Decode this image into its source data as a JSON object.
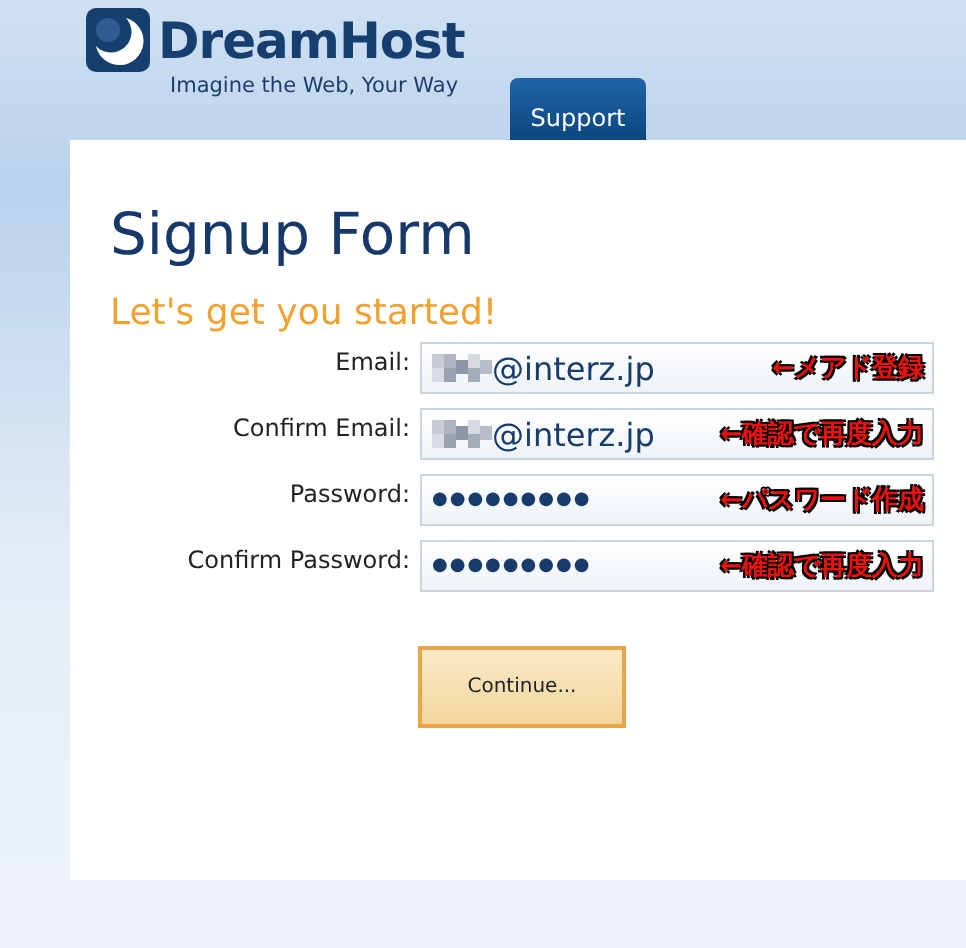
{
  "header": {
    "logo_text": "DreamHost",
    "tagline": "Imagine the Web, Your Way",
    "tabs": [
      {
        "label": "Support",
        "selected": true
      }
    ]
  },
  "title": "Signup Form",
  "subtitle": "Let's get you started!",
  "fields": [
    {
      "label": "Email:",
      "value": "@interz.jp",
      "masked_prefix": true,
      "note": "←メアド登録"
    },
    {
      "label": "Confirm Email:",
      "value": "@interz.jp",
      "masked_prefix": true,
      "note": "←確認で再度入力"
    },
    {
      "label": "Password:",
      "value": "●●●●●●●●●",
      "masked_prefix": false,
      "note": "←パスワード作成"
    },
    {
      "label": "Confirm Password:",
      "value": "●●●●●●●●●",
      "masked_prefix": false,
      "note": "←確認で再度入力"
    }
  ],
  "button": "Continue..."
}
